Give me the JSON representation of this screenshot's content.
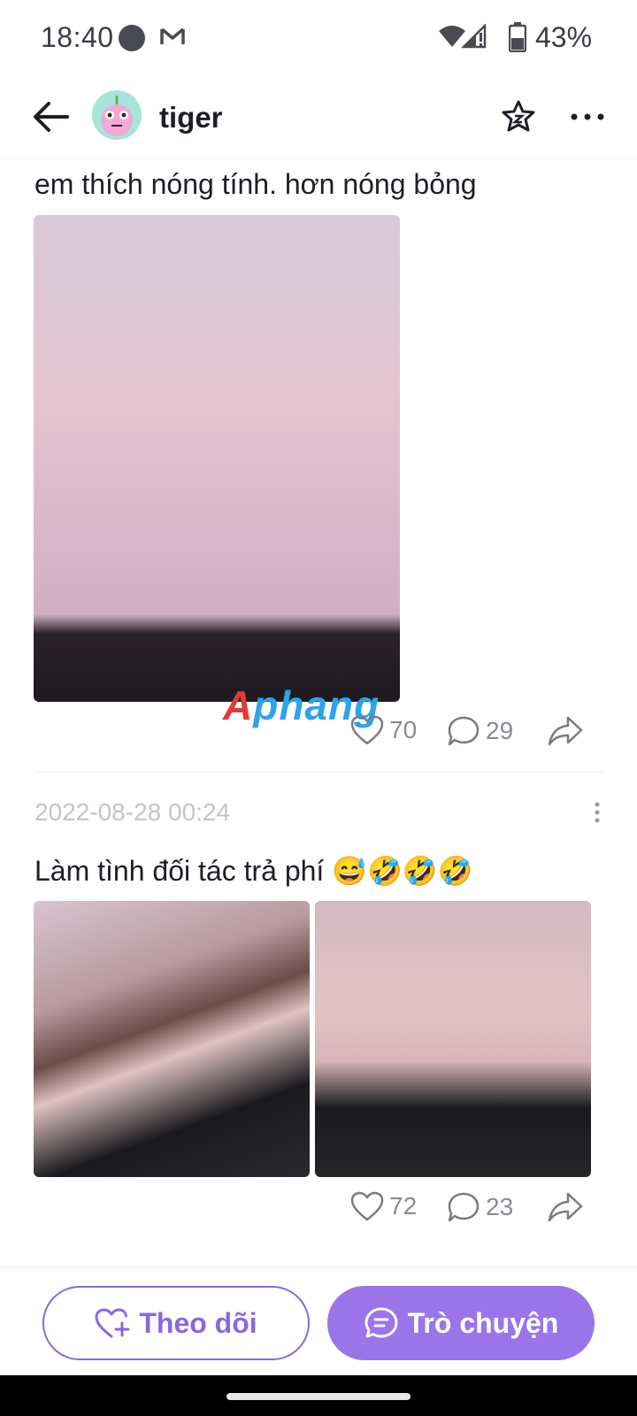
{
  "status_bar": {
    "time": "18:40",
    "battery": "43%"
  },
  "header": {
    "username": "tiger"
  },
  "posts": [
    {
      "text": "em thích nóng tính. hơn nóng bỏng",
      "likes": "70",
      "comments": "29"
    },
    {
      "date": "2022-08-28 00:24",
      "text": "Làm tình đối tác trả phí 😅🤣🤣🤣",
      "likes": "72",
      "comments": "23"
    }
  ],
  "watermark": {
    "part1": "A",
    "part2": "phang"
  },
  "bottom": {
    "follow_label": "Theo dõi",
    "chat_label": "Trò chuyện"
  },
  "colors": {
    "accent": "#9b74ea",
    "accent_outline": "#8a68e0"
  }
}
